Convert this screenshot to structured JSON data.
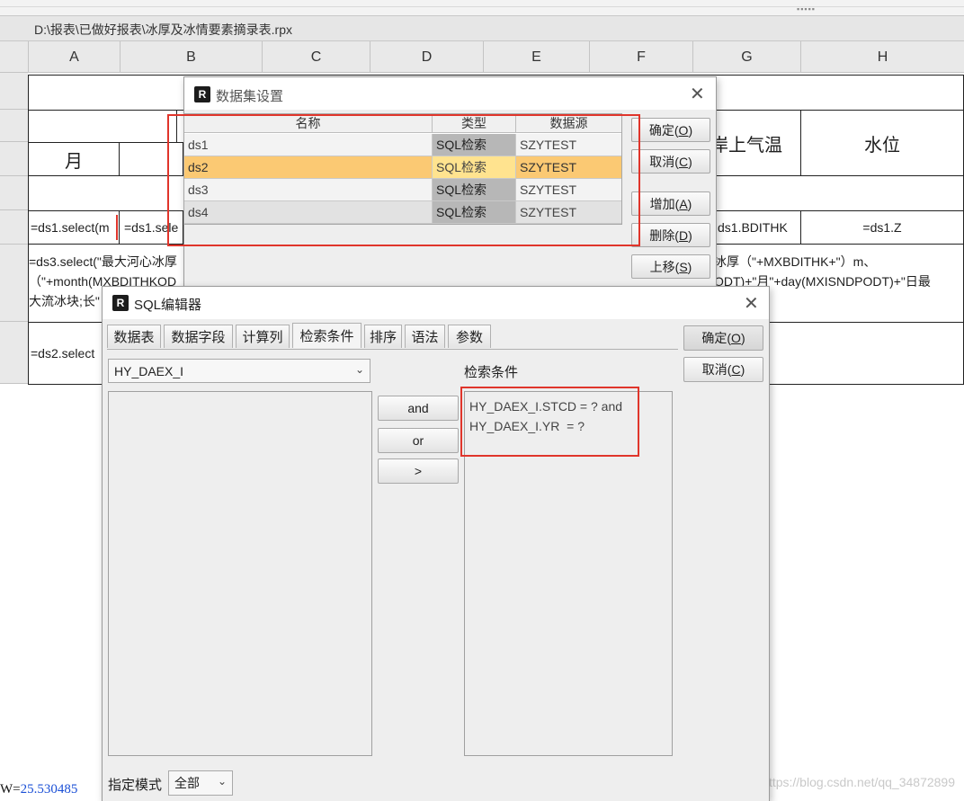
{
  "file_path": "D:\\报表\\已做好报表\\冰厚及冰情要素摘录表.rpx",
  "columns": [
    "A",
    "B",
    "C",
    "D",
    "E",
    "F",
    "G",
    "H"
  ],
  "sheet": {
    "month_label": "月",
    "air_temp_label": "岸上气温",
    "water_level_label": "水位",
    "row4": {
      "a": "=ds1.select(m",
      "b": "=ds1.sele",
      "g": "ds1.BDITHK",
      "h": "=ds1.Z"
    },
    "row5_left_line1": "=ds3.select(\"最大河心冰厚",
    "row5_left_line2": "（\"+month(MXBDITHKOD",
    "row5_left_line3": "大流冰块;长\"",
    "row5_right_line1": "冰厚（\"+MXBDITHK+\"）m、",
    "row5_right_line2": "ODT)+\"月\"+day(MXISNDPODT)+\"日最",
    "row6_a": "=ds2.select"
  },
  "status": {
    "prefix": "W=",
    "value": "25.530485"
  },
  "watermark": "https://blog.csdn.net/qq_34872899",
  "dataset_dialog": {
    "title": "数据集设置",
    "headers": [
      "名称",
      "类型",
      "数据源"
    ],
    "rows": [
      {
        "name": "ds1",
        "type": "SQL检索",
        "source": "SZYTEST",
        "selected": false
      },
      {
        "name": "ds2",
        "type": "SQL检索",
        "source": "SZYTEST",
        "selected": true
      },
      {
        "name": "ds3",
        "type": "SQL检索",
        "source": "SZYTEST",
        "selected": false
      },
      {
        "name": "ds4",
        "type": "SQL检索",
        "source": "SZYTEST",
        "selected": false
      }
    ],
    "buttons": {
      "ok": "确定",
      "ok_key": "O",
      "cancel": "取消",
      "cancel_key": "C",
      "add": "增加",
      "add_key": "A",
      "delete": "删除",
      "delete_key": "D",
      "up": "上移",
      "up_key": "S"
    }
  },
  "sql_editor": {
    "title": "SQL编辑器",
    "tabs": [
      "数据表",
      "数据字段",
      "计算列",
      "检索条件",
      "排序",
      "语法",
      "参数"
    ],
    "active_tab": "检索条件",
    "table_select": "HY_DAEX_I",
    "condition_label": "检索条件",
    "op_buttons": [
      "and",
      "or",
      ">"
    ],
    "conditions": [
      "HY_DAEX_I.STCD = ? and",
      "HY_DAEX_I.YR  = ?"
    ],
    "ok": "确定",
    "ok_key": "O",
    "cancel": "取消",
    "cancel_key": "C",
    "mode_label": "指定模式",
    "mode_value": "全部"
  },
  "colors": {
    "highlight_row": "#fbc973",
    "highlight_type": "#ffe38f",
    "red_box": "#e0352b"
  }
}
